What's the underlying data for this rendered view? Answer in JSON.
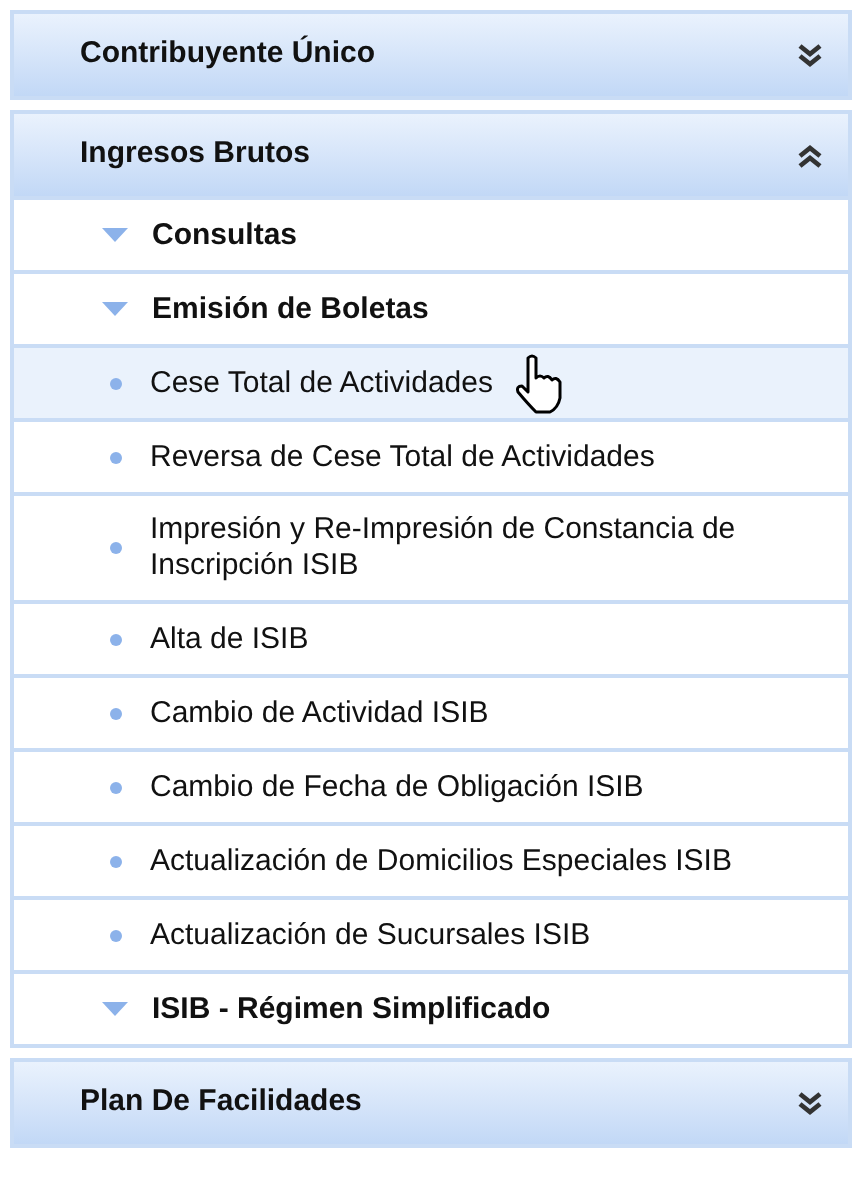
{
  "sections": [
    {
      "title": "Contribuyente Único",
      "expanded": false
    },
    {
      "title": "Ingresos Brutos",
      "expanded": true,
      "items": [
        {
          "kind": "group",
          "label": "Consultas",
          "hovered": false
        },
        {
          "kind": "group",
          "label": "Emisión de Boletas",
          "hovered": false
        },
        {
          "kind": "link",
          "label": "Cese Total de Actividades",
          "hovered": true
        },
        {
          "kind": "link",
          "label": "Reversa de Cese Total de Actividades",
          "hovered": false
        },
        {
          "kind": "link",
          "label": "Impresión y Re-Impresión de Constancia de Inscripción ISIB",
          "hovered": false
        },
        {
          "kind": "link",
          "label": "Alta de ISIB",
          "hovered": false
        },
        {
          "kind": "link",
          "label": "Cambio de Actividad ISIB",
          "hovered": false
        },
        {
          "kind": "link",
          "label": "Cambio de Fecha de Obligación ISIB",
          "hovered": false
        },
        {
          "kind": "link",
          "label": "Actualización de Domicilios Especiales ISIB",
          "hovered": false
        },
        {
          "kind": "link",
          "label": "Actualización de Sucursales ISIB",
          "hovered": false
        },
        {
          "kind": "group",
          "label": "ISIB - Régimen Simplificado",
          "hovered": false
        }
      ]
    },
    {
      "title": "Plan De Facilidades",
      "expanded": false
    }
  ]
}
